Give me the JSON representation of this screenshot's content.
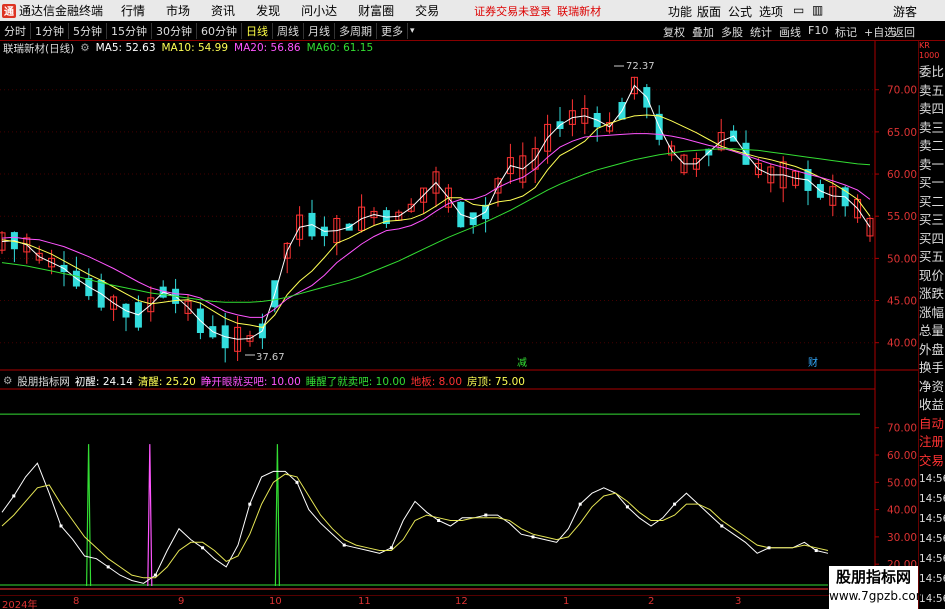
{
  "titlebar": {
    "logo_text": "通",
    "app_title": "通达信金融终端",
    "menus": [
      "行情",
      "市场",
      "资讯",
      "发现",
      "问小达",
      "财富圈",
      "交易"
    ],
    "notice": "证券交易未登录",
    "stock_name": "联瑞新材",
    "right_menus": [
      "功能",
      "版面",
      "公式",
      "选项",
      "画线",
      "游客"
    ]
  },
  "toolbar": {
    "periods": [
      "分时",
      "1分钟",
      "5分钟",
      "15分钟",
      "30分钟",
      "60分钟",
      "日线",
      "周线",
      "月线",
      "多周期",
      "更多"
    ],
    "active_period": "日线",
    "tools": [
      "复权",
      "叠加",
      "多股",
      "统计",
      "画线",
      "F10",
      "标记",
      "+自选",
      "返回"
    ]
  },
  "main_chart": {
    "stock_label": "联瑞新材(日线)",
    "ma": [
      {
        "name": "MA5:",
        "value": "52.63",
        "color": "#ffffff"
      },
      {
        "name": "MA10:",
        "value": "54.99",
        "color": "#ffff55"
      },
      {
        "name": "MA20:",
        "value": "56.86",
        "color": "#ff55ff"
      },
      {
        "name": "MA60:",
        "value": "61.15",
        "color": "#33dd33"
      }
    ],
    "y_ticks": [
      "70.00",
      "65.00",
      "60.00",
      "55.00",
      "50.00",
      "45.00",
      "40.00"
    ],
    "y_range": [
      37,
      74
    ],
    "high_label": "72.37",
    "low_label": "37.67",
    "markers": [
      {
        "text": "减",
        "color": "#33dd33"
      },
      {
        "text": "财",
        "color": "#33aaff"
      }
    ]
  },
  "indicator": {
    "name": "股朋指标网",
    "lines": [
      {
        "name": "初醒:",
        "value": "24.14",
        "color": "#ffffff"
      },
      {
        "name": "清醒:",
        "value": "25.20",
        "color": "#ffff55"
      },
      {
        "name": "睁开眼就买吧:",
        "value": "10.00",
        "color": "#ff55ff"
      },
      {
        "name": "睡醒了就卖吧:",
        "value": "10.00",
        "color": "#33dd33"
      },
      {
        "name": "地板:",
        "value": "8.00",
        "color": "#ff3333"
      },
      {
        "name": "房顶:",
        "value": "75.00",
        "color": "#ffff55"
      }
    ],
    "y_ticks": [
      "70.00",
      "60.00",
      "50.00",
      "40.00",
      "30.00",
      "20.00"
    ],
    "y_range": [
      12,
      82
    ]
  },
  "x_axis": {
    "labels": [
      "2024年",
      "8",
      "9",
      "10",
      "11",
      "12",
      "1",
      "2",
      "3"
    ]
  },
  "right_panel": {
    "code": "KR",
    "code2": "1000",
    "items": [
      "委比",
      "卖五",
      "卖四",
      "卖三",
      "卖二",
      "卖一",
      "买一",
      "买二",
      "买三",
      "买四",
      "买五",
      "现价",
      "涨跌",
      "涨幅",
      "总量",
      "外盘",
      "换手",
      "净资",
      "收益"
    ],
    "items2": [
      "自动",
      "注册",
      "交易"
    ],
    "times": [
      "14:56",
      "14:56",
      "14:56",
      "14:56",
      "14:56",
      "14:56",
      "14:56"
    ]
  },
  "watermark": {
    "line1": "股朋指标网",
    "line2": "www.7gpzb.com"
  },
  "chart_data": [
    {
      "type": "candlestick",
      "title": "联瑞新材(日线)",
      "series": [
        {
          "name": "MA5",
          "values": [
            52.0,
            52.1,
            51.6,
            50.2,
            49.5,
            48.8,
            47.6,
            46.6,
            45.8,
            44.7,
            43.8,
            43.3,
            44.5,
            46.0,
            45.5,
            44.2,
            42.6,
            41.3,
            40.7,
            40.4,
            40.5,
            41.4,
            45.8,
            50.9,
            53.7,
            54.0,
            53.2,
            53.3,
            53.7,
            54.7,
            55.2,
            54.9,
            55.0,
            56.0,
            57.5,
            59.0,
            57.2,
            55.2,
            54.7,
            55.5,
            58.6,
            61.0,
            60.6,
            61.8,
            64.3,
            65.8,
            66.7,
            66.9,
            66.4,
            65.6,
            67.5,
            70.5,
            69.1,
            65.6,
            62.8,
            61.2,
            61.2,
            62.6,
            63.9,
            64.5,
            62.4,
            60.6,
            59.9,
            59.9,
            59.5,
            59.3,
            58.0,
            57.4,
            57.3,
            55.9,
            53.7
          ]
        },
        {
          "name": "MA10",
          "values": [
            52.2,
            52.0,
            51.7,
            51.1,
            50.5,
            49.7,
            48.9,
            48.1,
            47.4,
            46.6,
            45.8,
            45.0,
            44.6,
            44.8,
            45.0,
            45.1,
            44.7,
            43.8,
            42.9,
            42.3,
            42.1,
            41.8,
            43.3,
            45.7,
            47.3,
            48.5,
            50.1,
            51.8,
            52.4,
            53.2,
            53.9,
            54.4,
            54.5,
            54.7,
            55.3,
            56.2,
            57.2,
            57.2,
            56.4,
            56.2,
            56.7,
            56.9,
            57.4,
            58.4,
            60.5,
            62.2,
            63.0,
            63.9,
            65.4,
            66.0,
            66.5,
            66.9,
            67.0,
            66.9,
            66.3,
            65.6,
            64.9,
            64.1,
            63.3,
            62.8,
            62.4,
            62.0,
            61.7,
            61.3,
            60.9,
            60.3,
            59.6,
            58.9,
            58.0,
            57.0,
            55.0
          ]
        },
        {
          "name": "MA20",
          "values": [
            52.4,
            52.5,
            52.3,
            52.2,
            51.8,
            51.4,
            50.8,
            50.2,
            49.5,
            48.8,
            48.0,
            47.2,
            46.5,
            46.1,
            45.8,
            45.7,
            45.3,
            44.5,
            43.7,
            43.3,
            43.0,
            43.0,
            44.0,
            45.2,
            46.0,
            46.8,
            48.0,
            49.5,
            50.6,
            51.7,
            52.6,
            53.3,
            53.5,
            53.9,
            54.6,
            55.6,
            56.5,
            57.0,
            57.0,
            57.5,
            58.4,
            59.1,
            59.6,
            60.6,
            62.0,
            63.2,
            63.9,
            64.4,
            64.5,
            64.6,
            64.7,
            64.8,
            64.8,
            64.7,
            64.5,
            64.2,
            63.8,
            63.4,
            63.1,
            62.7,
            62.2,
            61.7,
            61.2,
            60.8,
            60.4,
            60.0,
            59.6,
            59.2,
            58.7,
            58.1,
            57.0
          ]
        },
        {
          "name": "MA60",
          "values": [
            49.5,
            49.3,
            49.1,
            48.8,
            48.5,
            48.2,
            47.9,
            47.5,
            47.1,
            46.8,
            46.5,
            46.2,
            45.9,
            45.7,
            45.5,
            45.3,
            45.1,
            44.9,
            44.8,
            44.8,
            44.8,
            44.9,
            45.1,
            45.4,
            45.8,
            46.2,
            46.6,
            47.0,
            47.4,
            47.9,
            48.5,
            49.1,
            49.7,
            50.4,
            51.1,
            51.8,
            52.5,
            53.1,
            53.7,
            54.3,
            55.0,
            55.7,
            56.5,
            57.3,
            58.1,
            58.8,
            59.4,
            60.0,
            60.5,
            60.9,
            61.3,
            61.7,
            62.0,
            62.3,
            62.5,
            62.7,
            62.8,
            62.9,
            63.0,
            63.0,
            62.9,
            62.8,
            62.6,
            62.4,
            62.2,
            62.0,
            61.8,
            61.6,
            61.4,
            61.2,
            61.1
          ]
        }
      ],
      "ylim": [
        37,
        74
      ]
    },
    {
      "type": "line",
      "title": "股朋指标网",
      "series": [
        {
          "name": "初醒",
          "values": [
            39,
            45,
            52,
            57,
            46,
            34,
            29,
            23,
            22,
            19,
            16,
            14,
            13,
            16,
            25,
            33,
            29,
            26,
            22,
            19,
            27,
            42,
            52,
            54,
            54,
            50,
            40,
            35,
            31,
            27,
            26,
            25,
            24,
            26,
            36,
            43,
            39,
            36,
            34,
            37,
            37,
            38,
            38,
            35,
            31,
            30,
            29,
            28,
            33,
            42,
            46,
            48,
            46,
            41,
            37,
            34,
            37,
            42,
            46,
            42,
            38,
            34,
            31,
            28,
            24,
            26,
            26,
            26,
            28,
            25,
            24
          ]
        },
        {
          "name": "清醒",
          "values": [
            34,
            38,
            43,
            48,
            49,
            42,
            36,
            30,
            26,
            22,
            19,
            16,
            15,
            15,
            19,
            25,
            28,
            28,
            25,
            21,
            23,
            31,
            42,
            50,
            53,
            52,
            45,
            38,
            33,
            29,
            27,
            26,
            25,
            25,
            29,
            36,
            38,
            37,
            36,
            36,
            37,
            37,
            37,
            36,
            33,
            31,
            30,
            29,
            30,
            35,
            41,
            45,
            46,
            43,
            39,
            36,
            36,
            38,
            42,
            42,
            40,
            36,
            33,
            30,
            27,
            26,
            26,
            26,
            27,
            26,
            25
          ]
        }
      ],
      "ylim": [
        12,
        82
      ]
    }
  ]
}
